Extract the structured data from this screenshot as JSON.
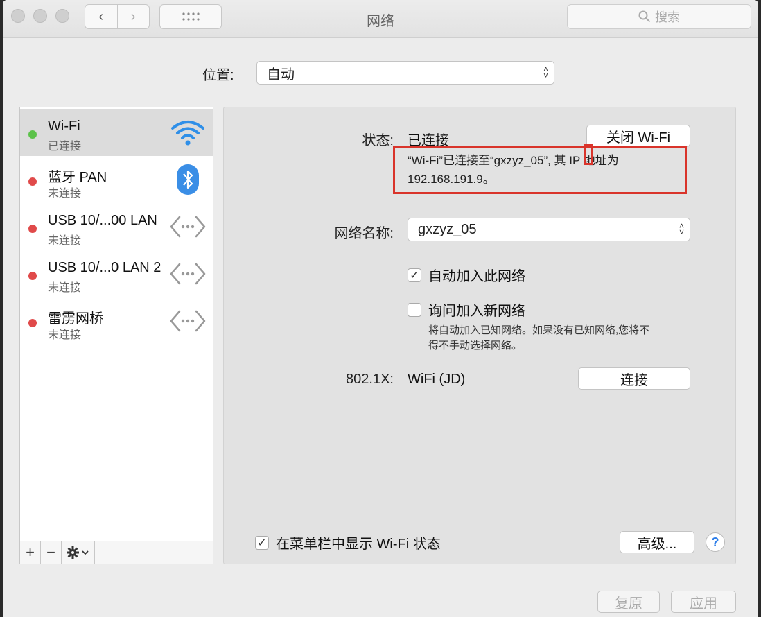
{
  "window": {
    "title": "网络",
    "search_placeholder": "搜索"
  },
  "location": {
    "label": "位置:",
    "value": "自动"
  },
  "sidebar": {
    "services": [
      {
        "name": "Wi-Fi",
        "status": "已连接",
        "icon": "wifi-icon",
        "status_color": "#5cc24a"
      },
      {
        "name": "蓝牙 PAN",
        "status": "未连接",
        "icon": "bluetooth-icon",
        "status_color": "#e04a4a"
      },
      {
        "name": "USB 10/...00 LAN",
        "status": "未连接",
        "icon": "ethernet-icon",
        "status_color": "#e04a4a"
      },
      {
        "name": "USB 10/...0 LAN 2",
        "status": "未连接",
        "icon": "ethernet-icon",
        "status_color": "#e04a4a"
      },
      {
        "name": "雷雳网桥",
        "status": "未连接",
        "icon": "ethernet-icon",
        "status_color": "#e04a4a"
      }
    ],
    "add": "+",
    "remove": "−"
  },
  "main": {
    "status_label": "状态:",
    "status_value": "已连接",
    "turn_off_button": "关闭 Wi-Fi",
    "status_desc_line1": "“Wi-Fi”已连接至“gxzyz_05”, 其 IP 地址为",
    "status_desc_line2": "192.168.191.9。",
    "network_name_label": "网络名称:",
    "network_name_value": "gxzyz_05",
    "auto_join_label": "自动加入此网络",
    "ask_join_label": "询问加入新网络",
    "ask_join_help_line1": "将自动加入已知网络。如果没有已知网络,您将不",
    "ask_join_help_line2": "得不手动选择网络。",
    "dot1x_label": "802.1X:",
    "dot1x_value": "WiFi (JD)",
    "connect_button": "连接",
    "show_status_label": "在菜单栏中显示 Wi-Fi 状态",
    "advanced_button": "高级...",
    "help_button": "?"
  },
  "footer": {
    "revert_button": "复原",
    "apply_button": "应用"
  },
  "colors": {
    "highlight_box": "#d9342b",
    "accent": "#2b7de9"
  }
}
